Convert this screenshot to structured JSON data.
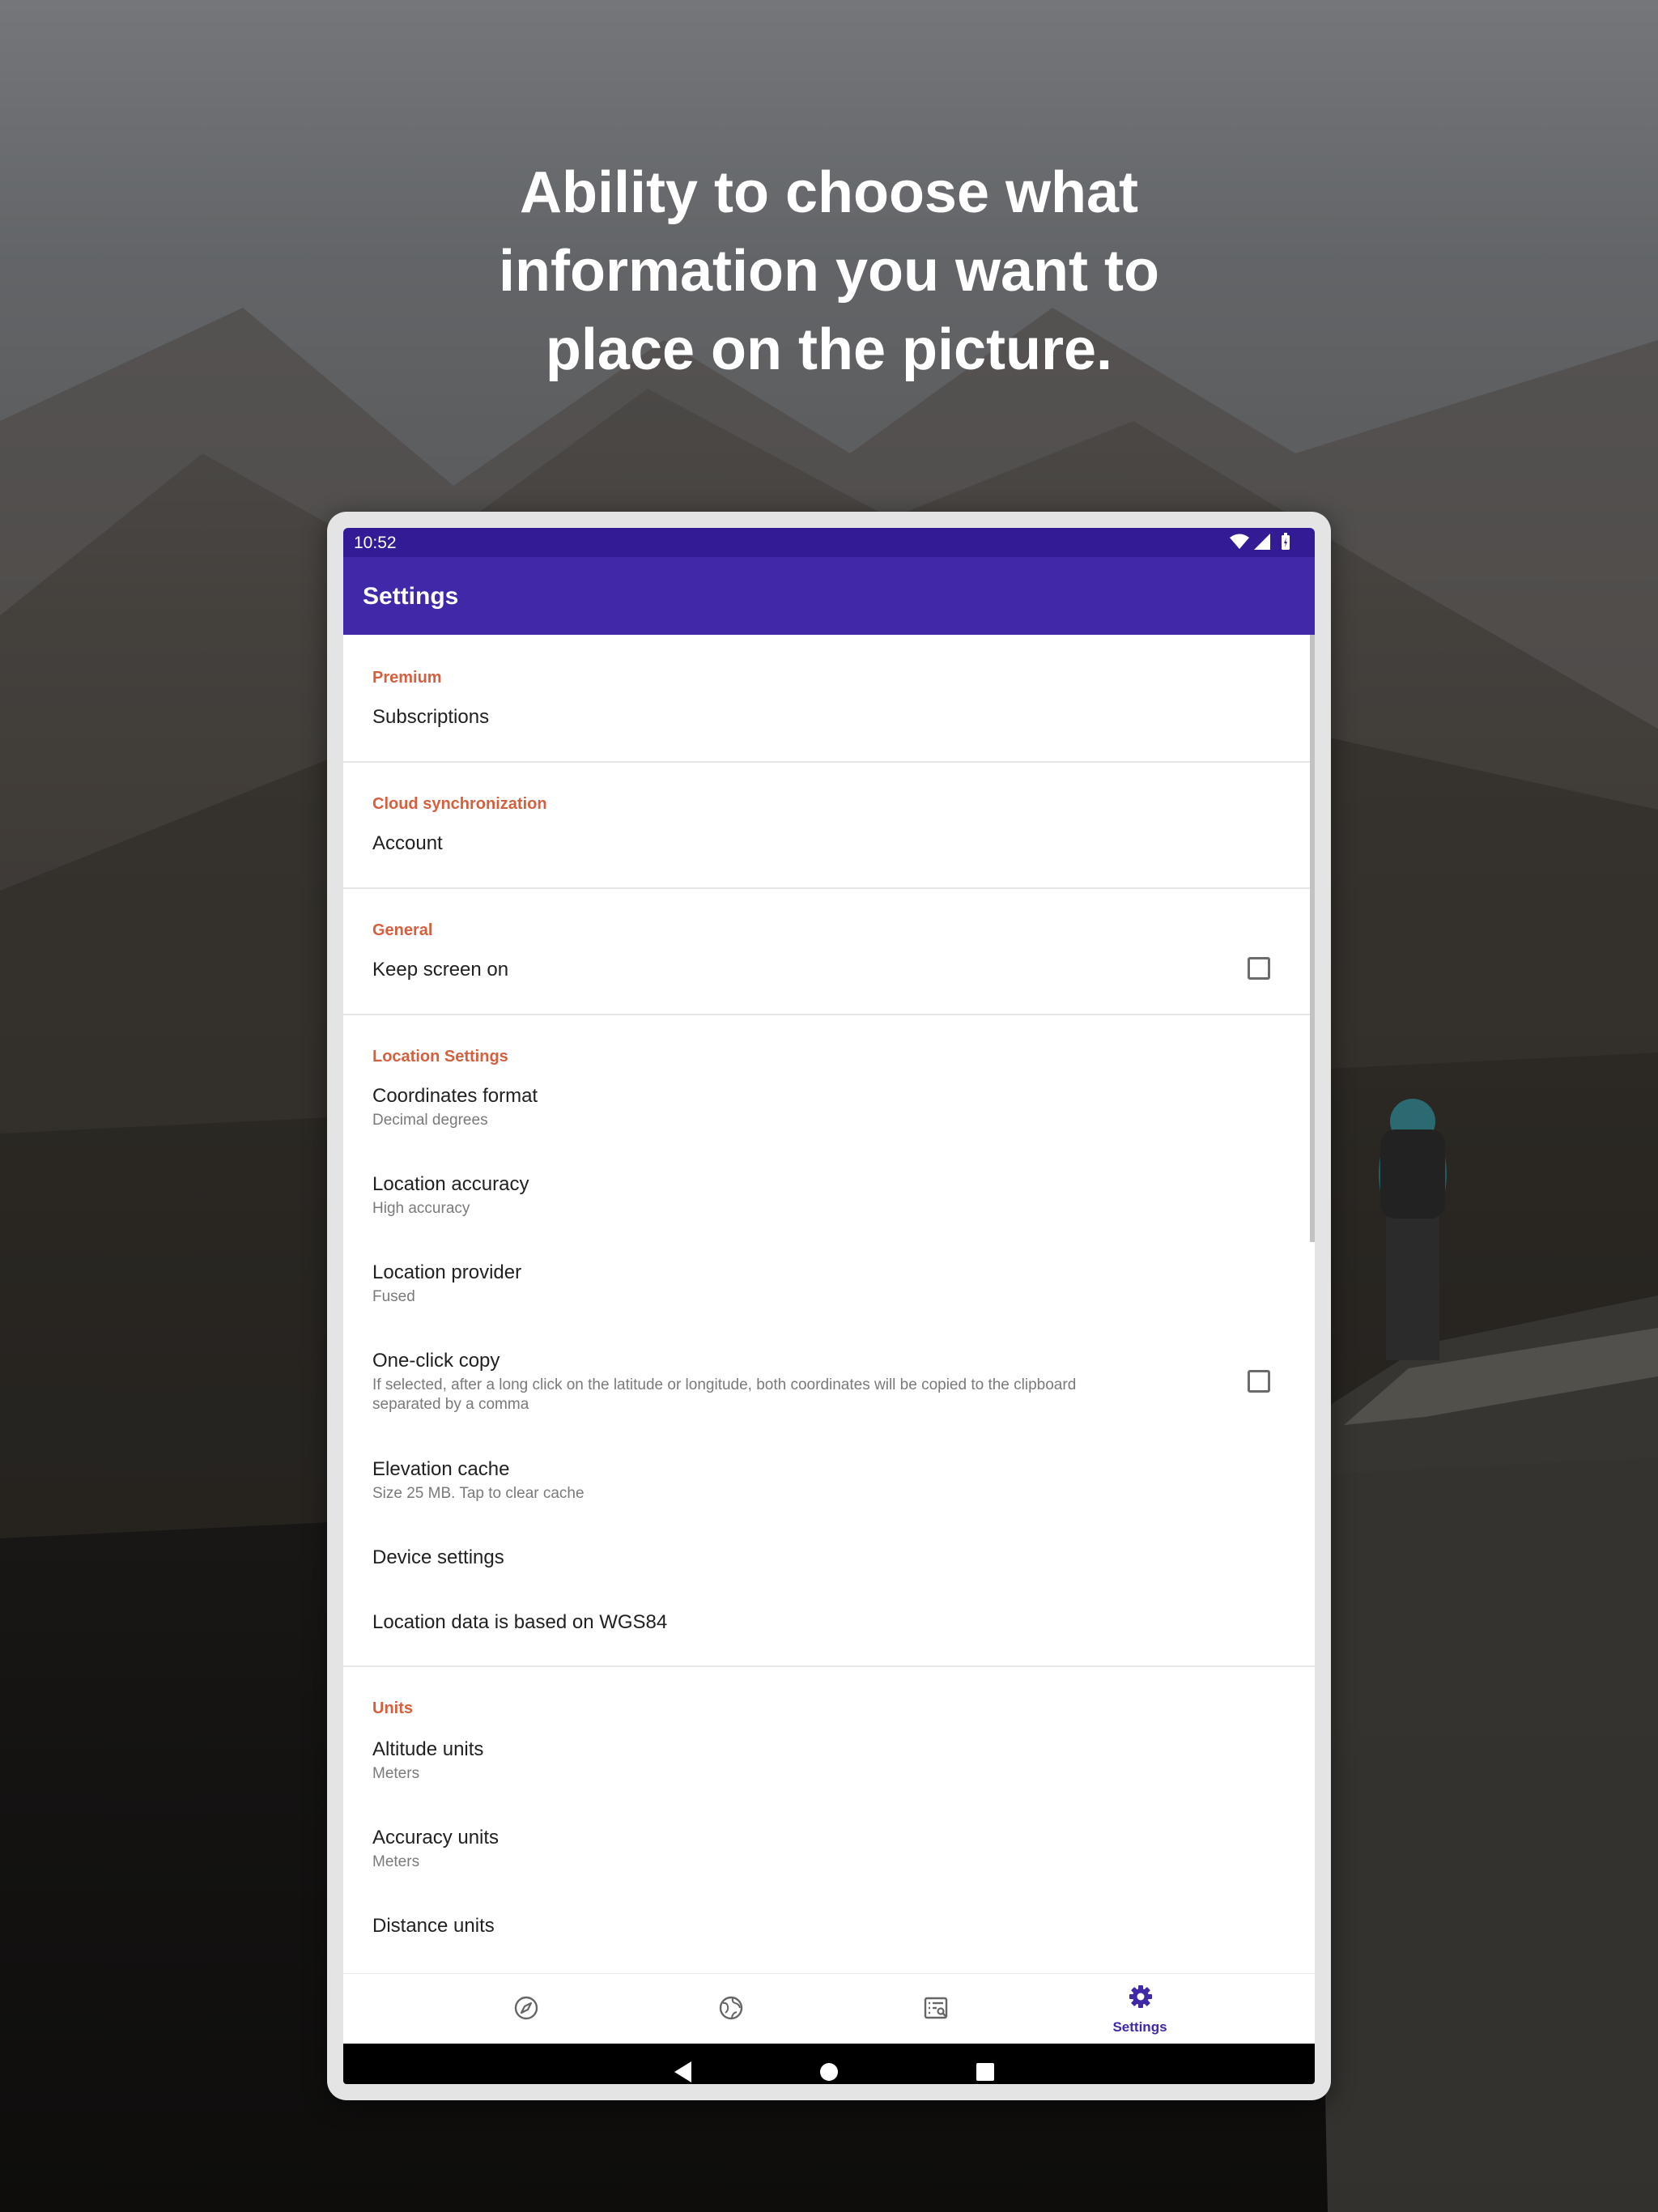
{
  "headline": {
    "line1": "Ability to choose what",
    "line2": "information you want to",
    "line3": "place on the picture."
  },
  "status_bar": {
    "time": "10:52",
    "icons": [
      "wifi-icon",
      "signal-icon",
      "battery-icon"
    ]
  },
  "app_bar": {
    "title": "Settings"
  },
  "sections": {
    "premium": {
      "header": "Premium",
      "subscriptions": "Subscriptions"
    },
    "cloud": {
      "header": "Cloud synchronization",
      "account": "Account"
    },
    "general": {
      "header": "General",
      "keep_screen_on": "Keep screen on",
      "keep_screen_on_checked": false
    },
    "location": {
      "header": "Location Settings",
      "coordinates_format": {
        "title": "Coordinates format",
        "value": "Decimal degrees"
      },
      "location_accuracy": {
        "title": "Location accuracy",
        "value": "High accuracy"
      },
      "location_provider": {
        "title": "Location provider",
        "value": "Fused"
      },
      "one_click_copy": {
        "title": "One-click copy",
        "desc_line1": "If selected, after a long click on the latitude or longitude, both coordinates will be copied to the clipboard",
        "desc_line2": "separated by a comma",
        "checked": false
      },
      "elevation_cache": {
        "title": "Elevation cache",
        "value": "Size 25 MB. Tap to clear cache"
      },
      "device_settings": "Device settings",
      "wgs84": "Location data is based on WGS84"
    },
    "units": {
      "header": "Units",
      "altitude_units": {
        "title": "Altitude units",
        "value": "Meters"
      },
      "accuracy_units": {
        "title": "Accuracy units",
        "value": "Meters"
      },
      "distance_units": {
        "title": "Distance units"
      }
    }
  },
  "bottom_nav": {
    "tabs": [
      {
        "icon": "compass-icon"
      },
      {
        "icon": "globe-icon"
      },
      {
        "icon": "list-search-icon"
      },
      {
        "icon": "gear-icon",
        "label": "Settings",
        "active": true
      }
    ]
  },
  "colors": {
    "status_bar": "#331b96",
    "app_bar": "#4128a8",
    "section_header": "#d4603f",
    "accent": "#4128a8"
  }
}
